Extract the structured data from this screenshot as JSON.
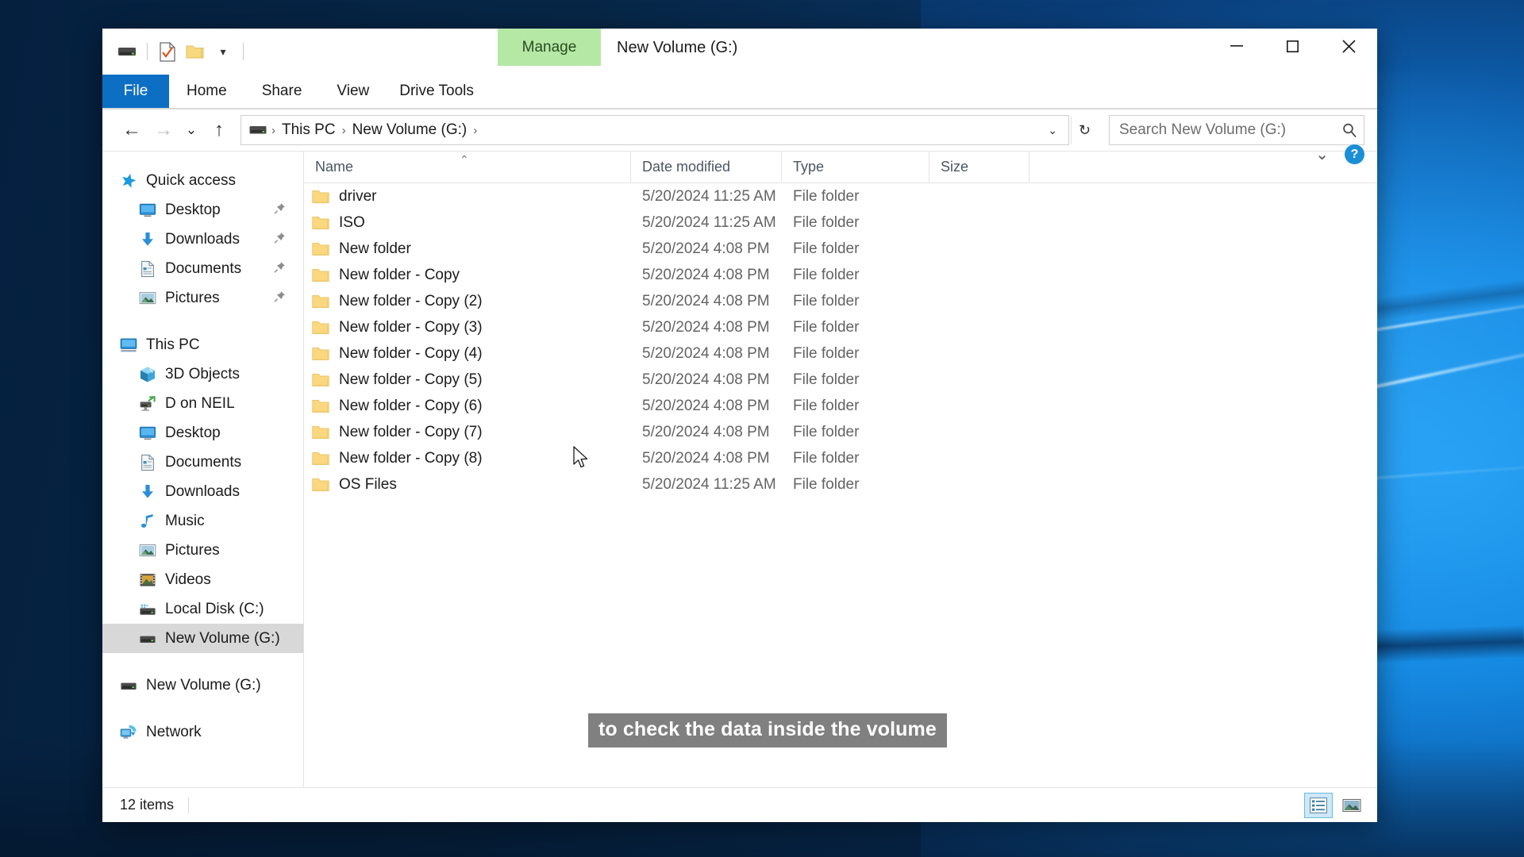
{
  "window": {
    "title": "New Volume (G:)",
    "contextual_tab_group": "Drive Tools",
    "contextual_tab_label": "Manage",
    "minimize_label": "–",
    "maximize_label": "☐",
    "close_label": "✕",
    "ribbon_expand_label": "⌄",
    "help_label": "?"
  },
  "quick_access_toolbar": {
    "items": [
      {
        "name": "drive-icon",
        "label": ""
      },
      {
        "name": "properties-icon",
        "label": ""
      },
      {
        "name": "new-folder-icon",
        "label": ""
      },
      {
        "name": "customize-dropdown-icon",
        "label": "▾"
      }
    ]
  },
  "ribbon": {
    "tabs": [
      {
        "id": "file",
        "label": "File",
        "active": true
      },
      {
        "id": "home",
        "label": "Home",
        "active": false
      },
      {
        "id": "share",
        "label": "Share",
        "active": false
      },
      {
        "id": "view",
        "label": "View",
        "active": false
      },
      {
        "id": "drive-tools",
        "label": "Drive Tools",
        "active": false
      }
    ]
  },
  "address_bar": {
    "back_label": "←",
    "forward_label": "→",
    "recent_label": "⌄",
    "up_label": "↑",
    "breadcrumbs": [
      {
        "label": "This PC"
      },
      {
        "label": "New Volume (G:)"
      }
    ],
    "separator": "›",
    "dropdown_label": "⌄",
    "refresh_label": "↻"
  },
  "search": {
    "placeholder": "Search New Volume (G:)",
    "value": "",
    "icon": "search-icon"
  },
  "sidebar": {
    "items": [
      {
        "id": "quick-access",
        "label": "Quick access",
        "icon": "star-icon",
        "level": "root",
        "pinned": false,
        "selected": false
      },
      {
        "id": "desktop-qa",
        "label": "Desktop",
        "icon": "monitor-icon",
        "level": "child",
        "pinned": true,
        "selected": false
      },
      {
        "id": "downloads-qa",
        "label": "Downloads",
        "icon": "download-arrow-icon",
        "level": "child",
        "pinned": true,
        "selected": false
      },
      {
        "id": "documents-qa",
        "label": "Documents",
        "icon": "document-icon",
        "level": "child",
        "pinned": true,
        "selected": false
      },
      {
        "id": "pictures-qa",
        "label": "Pictures",
        "icon": "picture-icon",
        "level": "child",
        "pinned": true,
        "selected": false
      },
      {
        "id": "gap-1",
        "label": "",
        "icon": "",
        "level": "gap",
        "pinned": false,
        "selected": false
      },
      {
        "id": "this-pc",
        "label": "This PC",
        "icon": "this-pc-icon",
        "level": "root",
        "pinned": false,
        "selected": false
      },
      {
        "id": "3d-objects",
        "label": "3D Objects",
        "icon": "cube-icon",
        "level": "child",
        "pinned": false,
        "selected": false
      },
      {
        "id": "d-on-neil",
        "label": "D on NEIL",
        "icon": "network-drive-icon",
        "level": "child",
        "pinned": false,
        "selected": false
      },
      {
        "id": "desktop-pc",
        "label": "Desktop",
        "icon": "monitor-icon",
        "level": "child",
        "pinned": false,
        "selected": false
      },
      {
        "id": "documents-pc",
        "label": "Documents",
        "icon": "document-icon",
        "level": "child",
        "pinned": false,
        "selected": false
      },
      {
        "id": "downloads-pc",
        "label": "Downloads",
        "icon": "download-arrow-icon",
        "level": "child",
        "pinned": false,
        "selected": false
      },
      {
        "id": "music-pc",
        "label": "Music",
        "icon": "music-note-icon",
        "level": "child",
        "pinned": false,
        "selected": false
      },
      {
        "id": "pictures-pc",
        "label": "Pictures",
        "icon": "picture-icon",
        "level": "child",
        "pinned": false,
        "selected": false
      },
      {
        "id": "videos-pc",
        "label": "Videos",
        "icon": "video-icon",
        "level": "child",
        "pinned": false,
        "selected": false
      },
      {
        "id": "local-disk-c",
        "label": "Local Disk (C:)",
        "icon": "hdd-icon",
        "level": "child",
        "pinned": false,
        "selected": false
      },
      {
        "id": "new-volume-g-pc",
        "label": "New Volume (G:)",
        "icon": "drive-icon",
        "level": "child",
        "pinned": false,
        "selected": true
      },
      {
        "id": "gap-2",
        "label": "",
        "icon": "",
        "level": "gap",
        "pinned": false,
        "selected": false
      },
      {
        "id": "new-volume-g-root",
        "label": "New Volume (G:)",
        "icon": "drive-icon",
        "level": "root",
        "pinned": false,
        "selected": false
      },
      {
        "id": "gap-3",
        "label": "",
        "icon": "",
        "level": "gap",
        "pinned": false,
        "selected": false
      },
      {
        "id": "network",
        "label": "Network",
        "icon": "network-icon",
        "level": "root",
        "pinned": false,
        "selected": false
      }
    ],
    "pin_glyph": "ᐱ"
  },
  "file_list": {
    "columns": [
      {
        "id": "name",
        "label": "Name",
        "sorted": "asc",
        "sort_glyph": "⌃"
      },
      {
        "id": "date",
        "label": "Date modified",
        "sorted": "",
        "sort_glyph": ""
      },
      {
        "id": "type",
        "label": "Type",
        "sorted": "",
        "sort_glyph": ""
      },
      {
        "id": "size",
        "label": "Size",
        "sorted": "",
        "sort_glyph": ""
      }
    ],
    "rows": [
      {
        "name": "driver",
        "date": "5/20/2024 11:25 AM",
        "type": "File folder",
        "size": "",
        "icon": "folder-icon"
      },
      {
        "name": "ISO",
        "date": "5/20/2024 11:25 AM",
        "type": "File folder",
        "size": "",
        "icon": "folder-icon"
      },
      {
        "name": "New folder",
        "date": "5/20/2024 4:08 PM",
        "type": "File folder",
        "size": "",
        "icon": "folder-icon"
      },
      {
        "name": "New folder - Copy",
        "date": "5/20/2024 4:08 PM",
        "type": "File folder",
        "size": "",
        "icon": "folder-icon"
      },
      {
        "name": "New folder - Copy (2)",
        "date": "5/20/2024 4:08 PM",
        "type": "File folder",
        "size": "",
        "icon": "folder-icon"
      },
      {
        "name": "New folder - Copy (3)",
        "date": "5/20/2024 4:08 PM",
        "type": "File folder",
        "size": "",
        "icon": "folder-icon"
      },
      {
        "name": "New folder - Copy (4)",
        "date": "5/20/2024 4:08 PM",
        "type": "File folder",
        "size": "",
        "icon": "folder-icon"
      },
      {
        "name": "New folder - Copy (5)",
        "date": "5/20/2024 4:08 PM",
        "type": "File folder",
        "size": "",
        "icon": "folder-icon"
      },
      {
        "name": "New folder - Copy (6)",
        "date": "5/20/2024 4:08 PM",
        "type": "File folder",
        "size": "",
        "icon": "folder-icon"
      },
      {
        "name": "New folder - Copy (7)",
        "date": "5/20/2024 4:08 PM",
        "type": "File folder",
        "size": "",
        "icon": "folder-icon"
      },
      {
        "name": "New folder - Copy (8)",
        "date": "5/20/2024 4:08 PM",
        "type": "File folder",
        "size": "",
        "icon": "folder-icon"
      },
      {
        "name": "OS Files",
        "date": "5/20/2024 11:25 AM",
        "type": "File folder",
        "size": "",
        "icon": "folder-icon"
      }
    ]
  },
  "status_bar": {
    "item_count": "12 items",
    "views": [
      {
        "id": "details-view",
        "label": "",
        "icon": "details-view-icon",
        "active": true
      },
      {
        "id": "large-icons-view",
        "label": "",
        "icon": "large-icons-view-icon",
        "active": false
      }
    ]
  },
  "caption": {
    "text": "to check the data inside the volume"
  },
  "colors": {
    "accent_blue": "#0d6fc4",
    "contextual_green": "#b5e8a5",
    "selection_gray": "#d8d8d8",
    "folder_yellow": "#fbd77f",
    "caption_bg": "#808080",
    "desktop_blue": "#1f9cf0"
  }
}
